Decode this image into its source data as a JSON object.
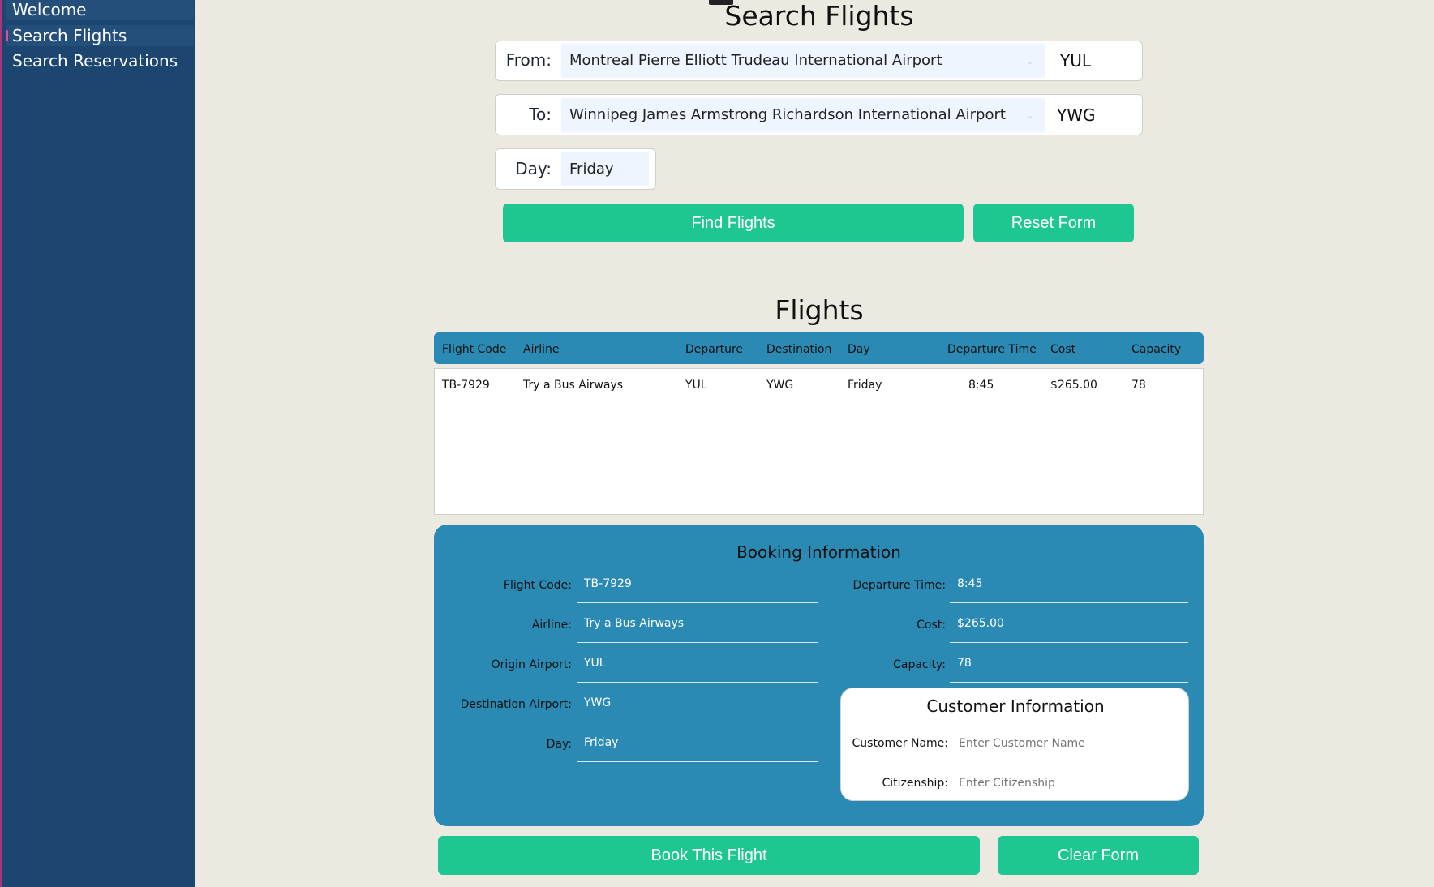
{
  "sidebar": {
    "items": [
      {
        "label": "Welcome"
      },
      {
        "label": "Search Flights"
      },
      {
        "label": "Search Reservations"
      }
    ]
  },
  "search": {
    "title": "Search Flights",
    "from_label": "From:",
    "from_value": "Montreal Pierre Elliott Trudeau International Airport",
    "from_code": "YUL",
    "to_label": "To:",
    "to_value": "Winnipeg James Armstrong Richardson International Airport",
    "to_code": "YWG",
    "day_label": "Day:",
    "day_value": "Friday",
    "find_button": "Find Flights",
    "reset_button": "Reset Form"
  },
  "flights": {
    "title": "Flights",
    "columns": [
      "Flight Code",
      "Airline",
      "Departure",
      "Destination",
      "Day",
      "Departure Time",
      "Cost",
      "Capacity"
    ],
    "rows": [
      [
        "TB-7929",
        "Try a Bus Airways",
        "YUL",
        "YWG",
        "Friday",
        "8:45",
        "$265.00",
        "78"
      ]
    ]
  },
  "booking": {
    "title": "Booking Information",
    "labels": {
      "flight_code": "Flight Code:",
      "airline": "Airline:",
      "origin": "Origin Airport:",
      "destination": "Destination Airport:",
      "day": "Day:",
      "departure_time": "Departure Time:",
      "cost": "Cost:",
      "capacity": "Capacity:"
    },
    "values": {
      "flight_code": "TB-7929",
      "airline": "Try a Bus Airways",
      "origin": "YUL",
      "destination": "YWG",
      "day": "Friday",
      "departure_time": "8:45",
      "cost": "$265.00",
      "capacity": "78"
    },
    "customer": {
      "title": "Customer Information",
      "name_label": "Customer Name:",
      "name_placeholder": "Enter Customer Name",
      "citizenship_label": "Citizenship:",
      "citizenship_placeholder": "Enter Citizenship"
    },
    "book_button": "Book This Flight",
    "clear_button": "Clear Form"
  }
}
